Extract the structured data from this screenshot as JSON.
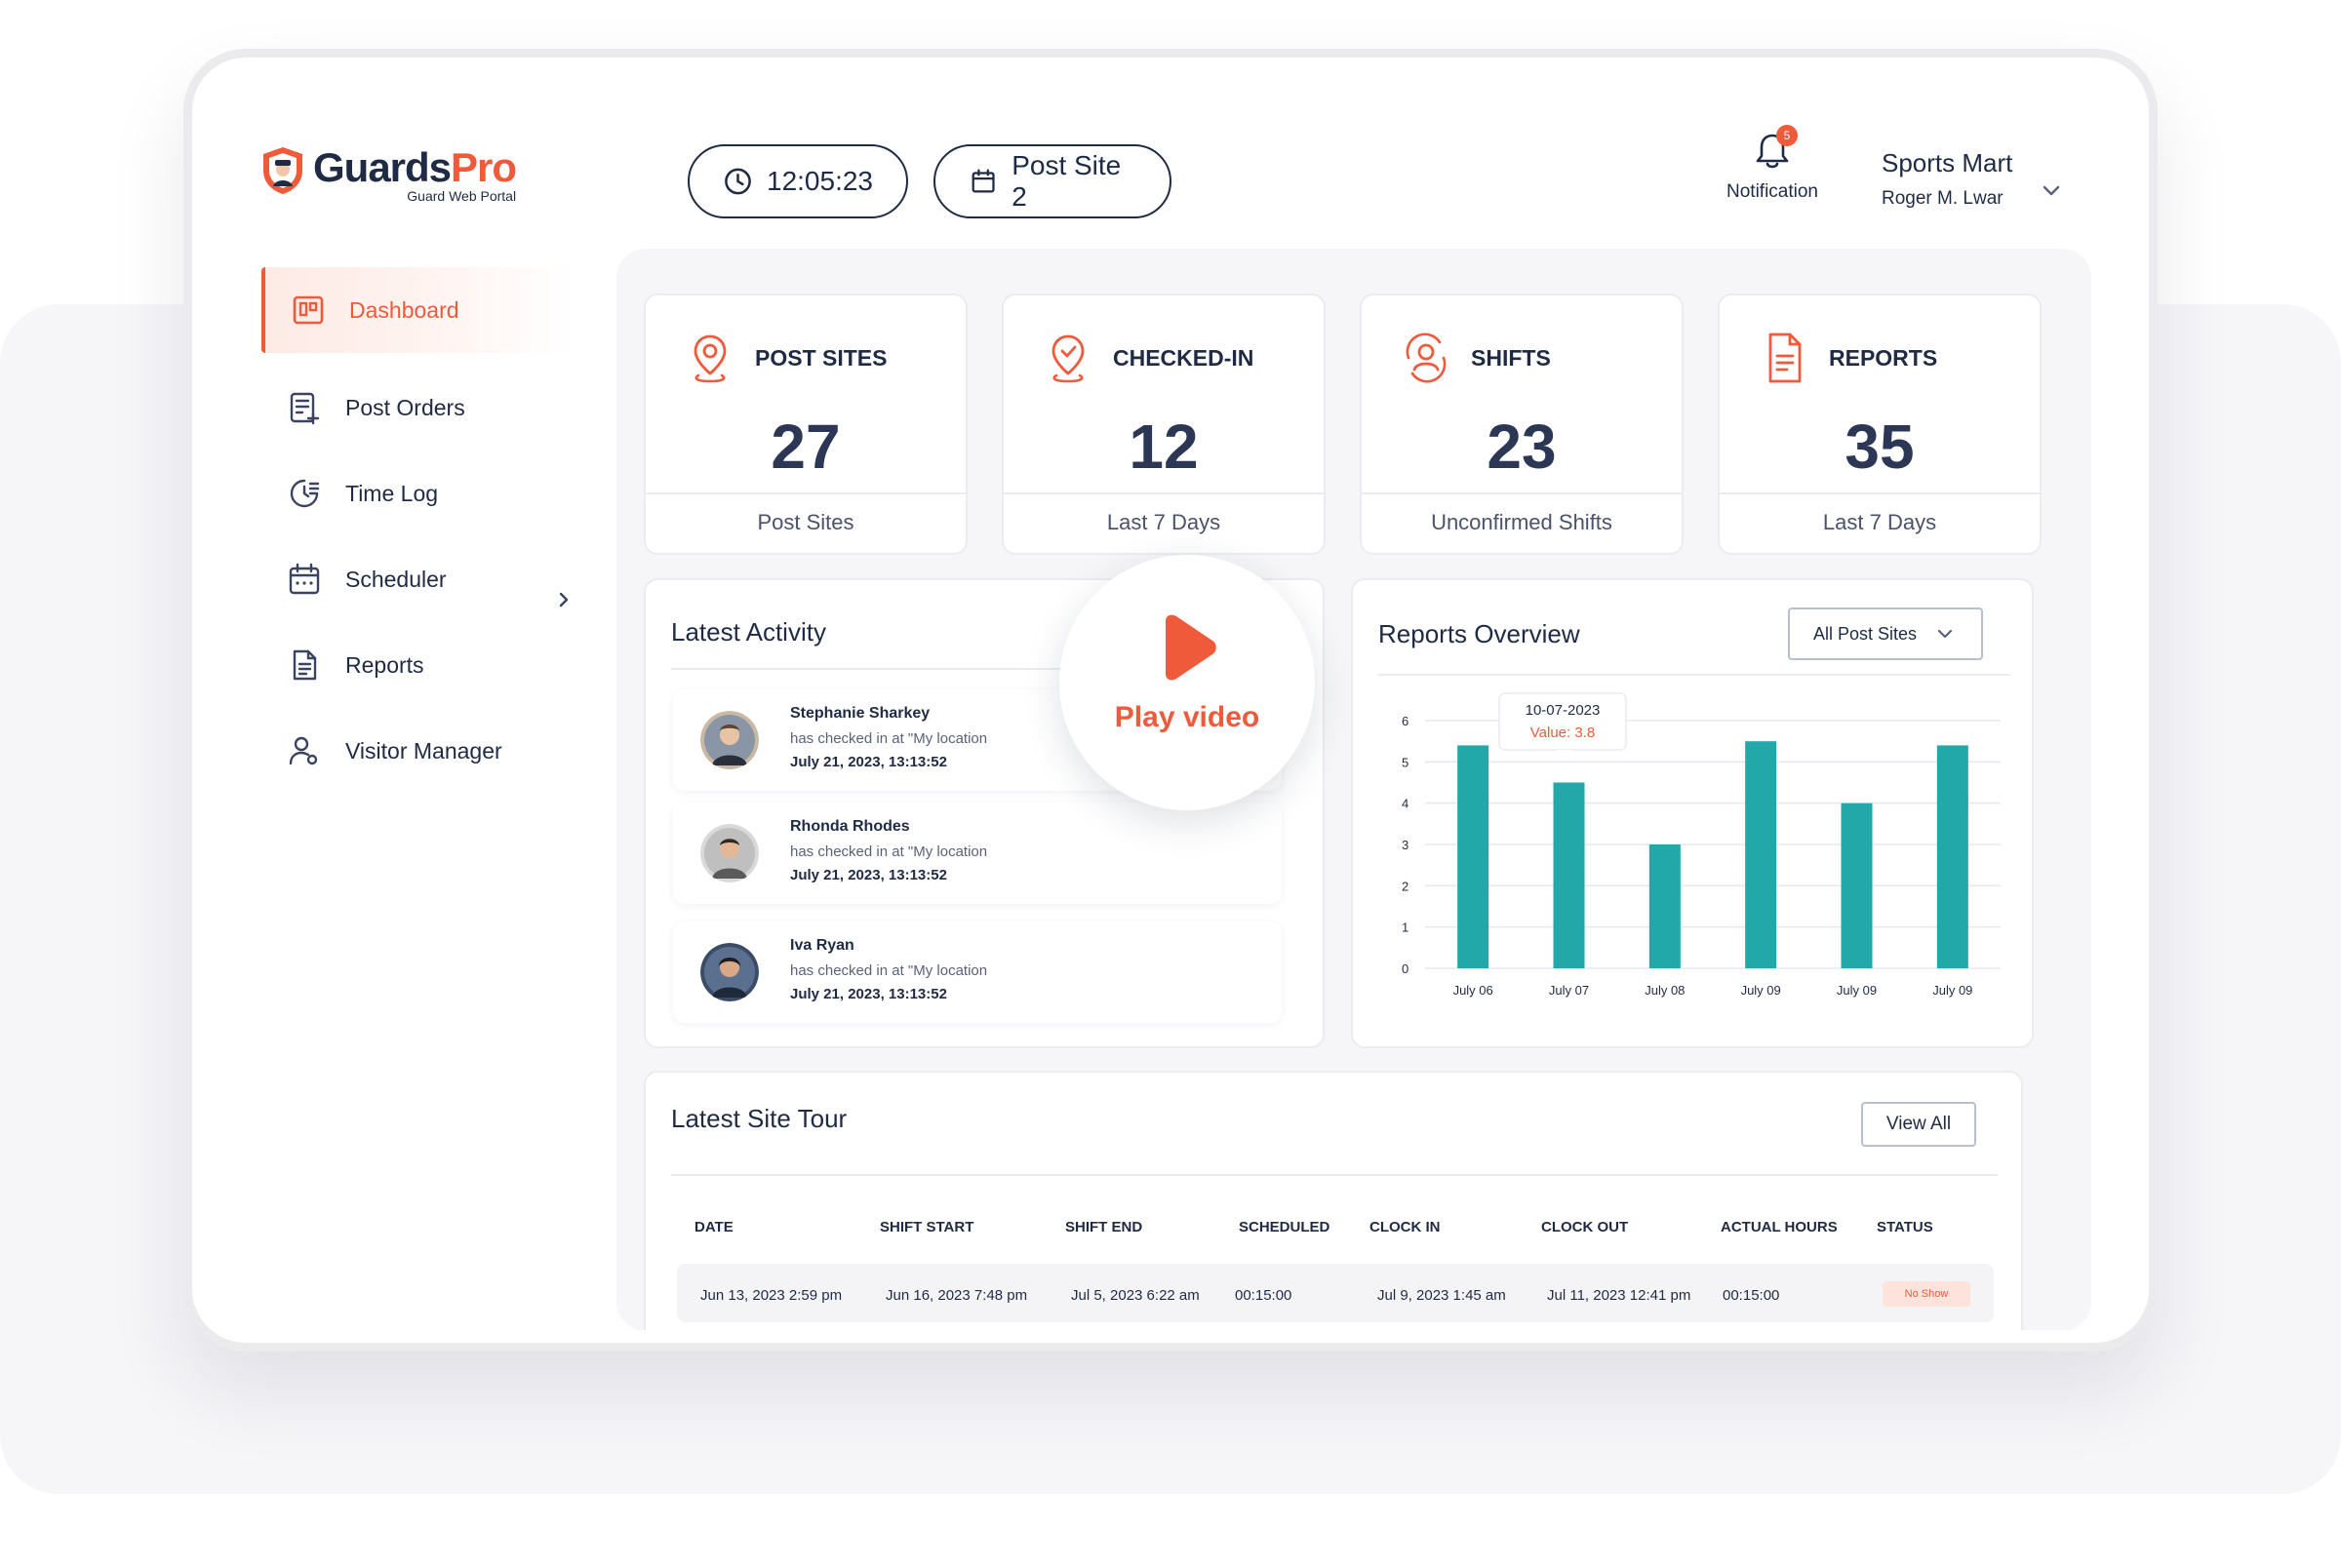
{
  "brand": {
    "name_part1": "Guards",
    "name_part2": "Pro",
    "subtitle": "Guard Web Portal"
  },
  "header": {
    "clock": "12:05:23",
    "site": "Post Site 2",
    "notification_label": "Notification",
    "notification_count": "5",
    "company": "Sports Mart",
    "user": "Roger M. Lwar"
  },
  "sidebar": {
    "items": [
      {
        "label": "Dashboard",
        "icon": "dashboard-icon",
        "active": true
      },
      {
        "label": "Post Orders",
        "icon": "post-orders-icon"
      },
      {
        "label": "Time Log",
        "icon": "time-log-icon"
      },
      {
        "label": "Scheduler",
        "icon": "calendar-icon",
        "has_submenu": true
      },
      {
        "label": "Reports",
        "icon": "document-icon"
      },
      {
        "label": "Visitor Manager",
        "icon": "visitor-icon"
      }
    ]
  },
  "stats": [
    {
      "title": "POST SITES",
      "value": "27",
      "footer": "Post Sites",
      "icon": "location-pin-icon"
    },
    {
      "title": "CHECKED-IN",
      "value": "12",
      "footer": "Last 7 Days",
      "icon": "location-check-icon"
    },
    {
      "title": "SHIFTS",
      "value": "23",
      "footer": "Unconfirmed Shifts",
      "icon": "shift-user-icon"
    },
    {
      "title": "REPORTS",
      "value": "35",
      "footer": "Last 7 Days",
      "icon": "report-icon"
    }
  ],
  "activity": {
    "title": "Latest Activity",
    "items": [
      {
        "name": "Stephanie Sharkey",
        "desc": "has checked in at \"My location",
        "time": "July 21, 2023, 13:13:52"
      },
      {
        "name": "Rhonda Rhodes",
        "desc": "has checked in at \"My location",
        "time": "July 21, 2023, 13:13:52"
      },
      {
        "name": "Iva Ryan",
        "desc": "has checked in at \"My location",
        "time": "July 21, 2023, 13:13:52"
      }
    ]
  },
  "video": {
    "label": "Play video"
  },
  "reports_overview": {
    "title": "Reports Overview",
    "filter": "All Post Sites",
    "tooltip_date": "10-07-2023",
    "tooltip_value": "Value: 3.8"
  },
  "chart_data": {
    "type": "bar",
    "categories": [
      "July 06",
      "July 07",
      "July 08",
      "July 09",
      "July 09",
      "July 09"
    ],
    "values": [
      5.4,
      4.5,
      3.0,
      5.5,
      4.0,
      5.4
    ],
    "ylim": [
      0,
      6
    ],
    "yticks": [
      "0",
      "1",
      "2",
      "3",
      "4",
      "5",
      "6"
    ],
    "color": "#22a8a8",
    "grid": true
  },
  "site_tour": {
    "title": "Latest Site Tour",
    "view_all": "View All",
    "columns": [
      "DATE",
      "SHIFT START",
      "SHIFT END",
      "SCHEDULED",
      "CLOCK IN",
      "CLOCK OUT",
      "ACTUAL HOURS",
      "STATUS"
    ],
    "rows": [
      [
        "Jun 13, 2023 2:59 pm",
        "Jun 16, 2023 7:48 pm",
        "Jul 5, 2023 6:22 am",
        "00:15:00",
        "Jul 9, 2023 1:45 am",
        "Jul 11, 2023 12:41 pm",
        "00:15:00",
        "No Show"
      ]
    ]
  },
  "colors": {
    "accent": "#ee5a3a",
    "navy": "#1f2a44",
    "teal": "#22a8a8"
  }
}
